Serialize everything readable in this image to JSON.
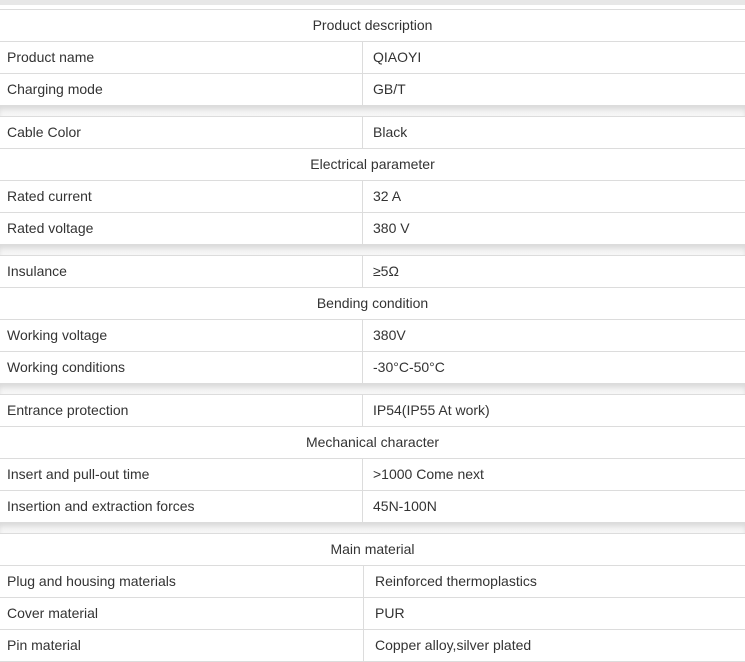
{
  "blocks": [
    {
      "rows": [
        {
          "type": "header",
          "text": "Product description"
        },
        {
          "type": "pair",
          "label": "Product name",
          "value": "QIAOYI"
        },
        {
          "type": "pair",
          "label": "Charging mode",
          "value": "GB/T"
        }
      ]
    },
    {
      "rows": [
        {
          "type": "pair",
          "label": "Cable Color",
          "value": "Black"
        },
        {
          "type": "header",
          "text": "Electrical parameter"
        },
        {
          "type": "pair",
          "label": "Rated current",
          "value": "32 A"
        },
        {
          "type": "pair",
          "label": "Rated voltage",
          "value": "380 V"
        }
      ]
    },
    {
      "rows": [
        {
          "type": "pair",
          "label": "Insulance",
          "value": "≥5Ω"
        },
        {
          "type": "header",
          "text": "Bending condition"
        },
        {
          "type": "pair",
          "label": "Working voltage",
          "value": "380V"
        },
        {
          "type": "pair",
          "label": "Working conditions",
          "value": "-30°C-50°C"
        }
      ]
    },
    {
      "rows": [
        {
          "type": "pair",
          "label": "Entrance protection",
          "value": "IP54(IP55 At work)"
        },
        {
          "type": "header",
          "text": "Mechanical character"
        },
        {
          "type": "pair",
          "label": "Insert and pull-out time",
          "value": ">1000 Come next"
        },
        {
          "type": "pair",
          "label": "Insertion and extraction forces",
          "value": "45N-100N"
        }
      ]
    },
    {
      "rows": [
        {
          "type": "header",
          "text": "Main material"
        },
        {
          "type": "pair",
          "label": "Plug and housing materials",
          "value": "Reinforced thermoplastics"
        },
        {
          "type": "pair",
          "label": "Cover material",
          "value": "PUR"
        },
        {
          "type": "pair",
          "label": "Pin material",
          "value": "Copper alloy,silver plated"
        }
      ]
    }
  ]
}
